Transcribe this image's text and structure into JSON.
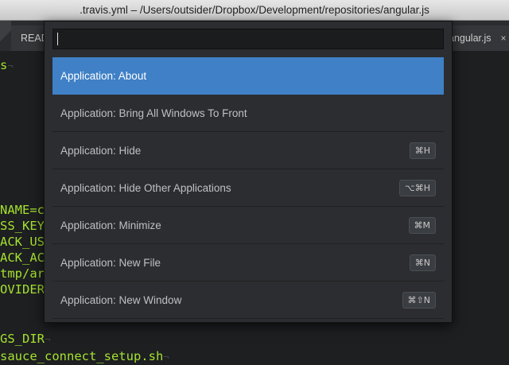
{
  "window": {
    "title": ".travis.yml – /Users/outsider/Dropbox/Development/repositories/angular.js"
  },
  "tabs": [
    {
      "label": "READ"
    },
    {
      "label": "angular.js",
      "close": "×"
    }
  ],
  "editor": {
    "lines": [
      {
        "text": "s",
        "eol": "¬"
      },
      {
        "text": "NAME=c",
        "eol": ""
      },
      {
        "text": "SS_KEY",
        "eol": ""
      },
      {
        "text": "ACK_US",
        "eol": ""
      },
      {
        "text": "ACK_AC",
        "eol": ""
      },
      {
        "text": "tmp/ar",
        "eol": ""
      },
      {
        "text": "OVIDER",
        "eol": ""
      },
      {
        "text": "GS_DIR",
        "eol": "¬"
      },
      {
        "text": "sauce_connect_setup.sh",
        "eol": "¬"
      }
    ]
  },
  "command_palette": {
    "search": {
      "value": "",
      "placeholder": ""
    },
    "items": [
      {
        "label": "Application: About",
        "shortcut": "",
        "selected": true
      },
      {
        "label": "Application: Bring All Windows To Front",
        "shortcut": ""
      },
      {
        "label": "Application: Hide",
        "shortcut": "⌘H"
      },
      {
        "label": "Application: Hide Other Applications",
        "shortcut": "⌥⌘H"
      },
      {
        "label": "Application: Minimize",
        "shortcut": "⌘M"
      },
      {
        "label": "Application: New File",
        "shortcut": "⌘N"
      },
      {
        "label": "Application: New Window",
        "shortcut": "⌘⇧N"
      }
    ]
  },
  "colors": {
    "selection": "#3f80c6",
    "code_green": "#a6e22e",
    "background": "#1d1f21"
  }
}
